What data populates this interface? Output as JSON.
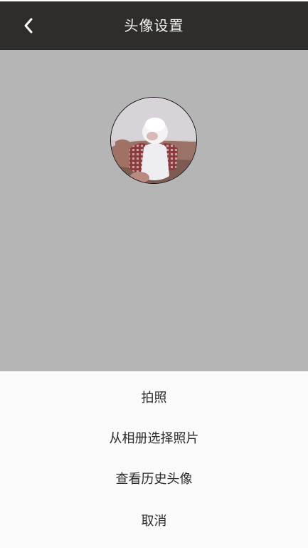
{
  "header": {
    "title": "头像设置",
    "back_icon": "chevron-left-icon"
  },
  "preview": {
    "avatar_description": "avatar-photo"
  },
  "action_sheet": {
    "items": [
      {
        "label": "拍照"
      },
      {
        "label": "从相册选择照片"
      },
      {
        "label": "查看历史头像"
      },
      {
        "label": "取消"
      }
    ]
  },
  "colors": {
    "title_bar": "#2e2d2b",
    "preview_bg": "#b5b5b5",
    "sheet_bg": "#fafafa"
  }
}
